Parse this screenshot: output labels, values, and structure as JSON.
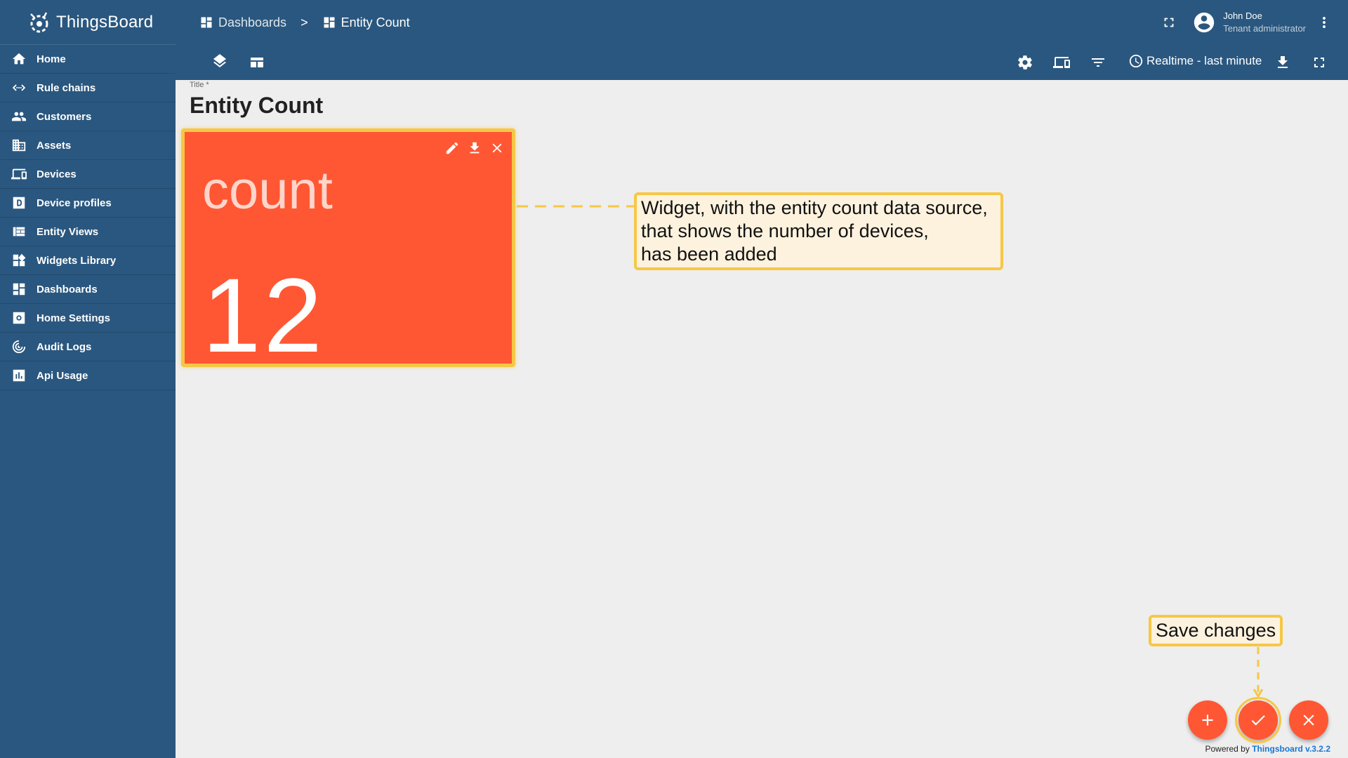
{
  "app": {
    "name": "ThingsBoard"
  },
  "sidebar": {
    "items": [
      {
        "label": "Home",
        "icon": "home-icon"
      },
      {
        "label": "Rule chains",
        "icon": "rule-chains-icon"
      },
      {
        "label": "Customers",
        "icon": "customers-icon"
      },
      {
        "label": "Assets",
        "icon": "assets-icon"
      },
      {
        "label": "Devices",
        "icon": "devices-icon"
      },
      {
        "label": "Device profiles",
        "icon": "device-profiles-icon"
      },
      {
        "label": "Entity Views",
        "icon": "entity-views-icon"
      },
      {
        "label": "Widgets Library",
        "icon": "widgets-library-icon"
      },
      {
        "label": "Dashboards",
        "icon": "dashboards-icon"
      },
      {
        "label": "Home Settings",
        "icon": "home-settings-icon"
      },
      {
        "label": "Audit Logs",
        "icon": "audit-logs-icon"
      },
      {
        "label": "Api Usage",
        "icon": "api-usage-icon"
      }
    ]
  },
  "header": {
    "breadcrumb": [
      {
        "label": "Dashboards"
      },
      {
        "label": "Entity Count"
      }
    ],
    "separator": ">",
    "user": {
      "name": "John Doe",
      "role": "Tenant administrator"
    }
  },
  "toolbar": {
    "timewindow": "Realtime - last minute"
  },
  "dashboard": {
    "title_label": "Title *",
    "title": "Entity Count"
  },
  "widget": {
    "label": "count",
    "value": "12",
    "color": "#ff5733",
    "highlight": "#f6c746"
  },
  "annotations": {
    "widget_note": [
      "Widget, with the entity count data source,",
      "that shows the number of devices,",
      "has been added"
    ],
    "save_note": "Save changes"
  },
  "footer": {
    "powered_prefix": "Powered by",
    "powered_link": "Thingsboard v.3.2.2"
  },
  "colors": {
    "primary": "#2a577f",
    "accent": "#ff5733",
    "annotation": "#f6c746"
  }
}
